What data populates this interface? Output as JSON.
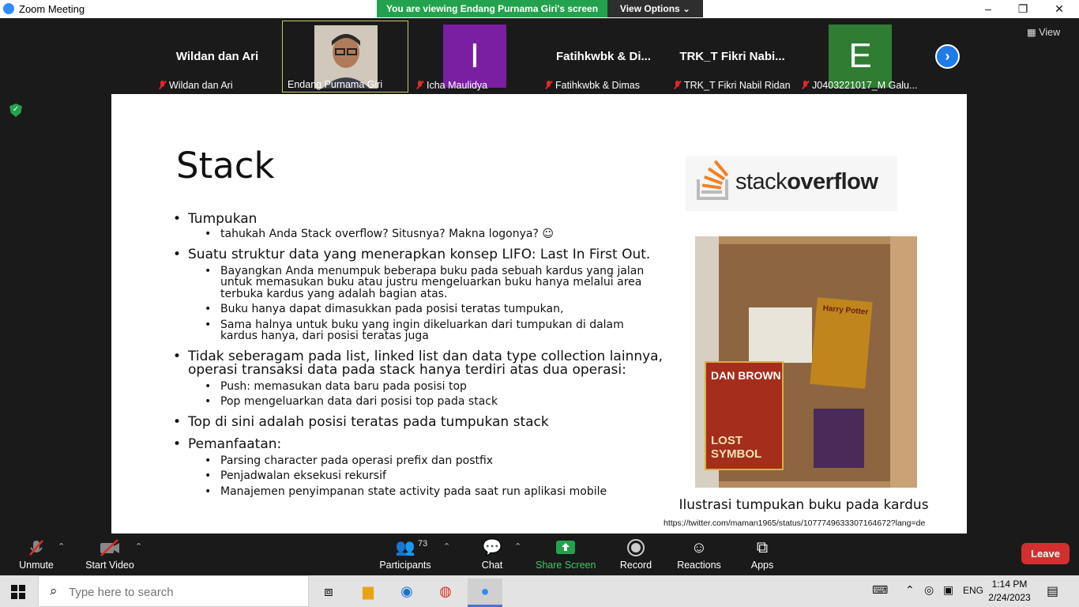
{
  "window": {
    "title": "Zoom Meeting",
    "controls": [
      "–",
      "❐",
      "✕"
    ]
  },
  "share_banner": {
    "text": "You are viewing Endang Purnama Giri's screen",
    "view_options": "View Options ⌄"
  },
  "gallery": {
    "view_label": "View",
    "tiles": [
      {
        "big_name": "Wildan dan Ari",
        "label": "Wildan dan Ari",
        "muted": true
      },
      {
        "big_name": "",
        "label": "Endang Purnama Giri",
        "muted": false,
        "active": true
      },
      {
        "avatar_letter": "I",
        "label": "Icha Maulidya",
        "muted": true,
        "color": "#7b1fa2"
      },
      {
        "big_name": "Fatihkwbk & Di...",
        "label": "Fatihkwbk & Dimas",
        "muted": true
      },
      {
        "big_name": "TRK_T Fikri Nabi...",
        "label": "TRK_T Fikri Nabil Ridan",
        "muted": true
      },
      {
        "avatar_letter": "E",
        "label": "J0403221017_M Galu...",
        "muted": true,
        "color": "#2e7d32"
      }
    ]
  },
  "slide": {
    "title": "Stack",
    "bullets": [
      {
        "text": "Tumpukan",
        "sub": [
          "tahukah Anda Stack overflow? Situsnya? Makna logonya? ☺"
        ]
      },
      {
        "text": "Suatu struktur data yang menerapkan konsep LIFO: Last In First Out.",
        "sub": [
          "Bayangkan Anda menumpuk beberapa buku pada sebuah kardus yang jalan untuk memasukan buku atau justru mengeluarkan buku hanya melalui area terbuka kardus yang adalah bagian atas.",
          "Buku hanya dapat dimasukkan pada posisi teratas tumpukan,",
          "Sama halnya untuk buku yang ingin dikeluarkan dari tumpukan di dalam kardus hanya, dari posisi teratas juga"
        ]
      },
      {
        "text": "Tidak seberagam pada list, linked list dan data type collection lainnya, operasi transaksi data pada stack hanya terdiri atas dua operasi:",
        "sub": [
          "Push: memasukan data baru pada posisi top",
          "Pop mengeluarkan data dari posisi top pada stack"
        ]
      },
      {
        "text": "Top di sini adalah posisi teratas pada tumpukan stack",
        "sub": []
      },
      {
        "text": "Pemanfaatan:",
        "sub": [
          "Parsing character pada operasi prefix dan postfix",
          "Penjadwalan eksekusi rekursif",
          "Manajemen penyimpanan state activity pada saat run aplikasi mobile"
        ]
      }
    ],
    "logo": {
      "word1": "stack",
      "word2": "overflow"
    },
    "photo": {
      "book1_author": "DAN BROWN",
      "book1_title": "LOST SYMBOL",
      "book2_title": "Harry Potter"
    },
    "caption": "Ilustrasi tumpukan buku pada kardus",
    "url": "https://twitter.com/maman1965/status/1077749633307164672?lang=de"
  },
  "toolbar": {
    "unmute": "Unmute",
    "start_video": "Start Video",
    "participants": "Participants",
    "participants_count": "73",
    "chat": "Chat",
    "share_screen": "Share Screen",
    "record": "Record",
    "reactions": "Reactions",
    "apps": "Apps",
    "leave": "Leave"
  },
  "taskbar": {
    "search_placeholder": "Type here to search",
    "language": "ENG",
    "time": "1:14 PM",
    "date": "2/24/2023"
  }
}
